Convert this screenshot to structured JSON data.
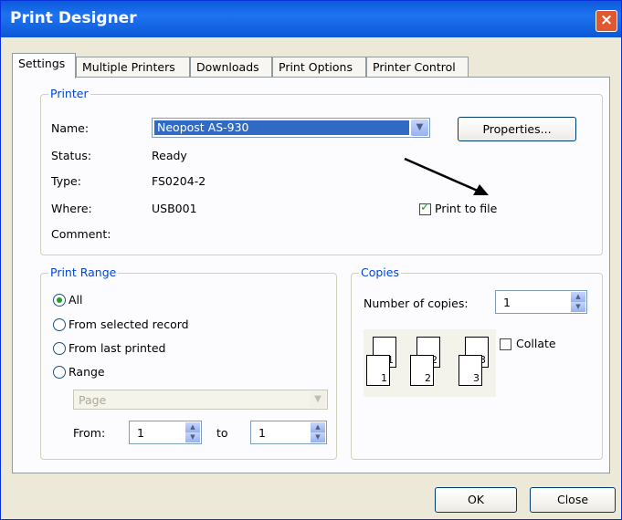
{
  "window": {
    "title": "Print Designer",
    "close_glyph": "×"
  },
  "tabs": [
    "Settings",
    "Multiple Printers",
    "Downloads",
    "Print Options",
    "Printer Control"
  ],
  "printer": {
    "legend": "Printer",
    "name_label": "Name:",
    "name_value": "Neopost AS-930",
    "status_label": "Status:",
    "status_value": "Ready",
    "type_label": "Type:",
    "type_value": "FS0204-2",
    "where_label": "Where:",
    "where_value": "USB001",
    "comment_label": "Comment:",
    "properties_button": "Properties...",
    "print_to_file_label": "Print to file",
    "print_to_file_checked": true
  },
  "print_range": {
    "legend": "Print Range",
    "options": [
      "All",
      "From selected record",
      "From last printed",
      "Range"
    ],
    "selected": "All",
    "range_unit": "Page",
    "from_label": "From:",
    "from_value": "1",
    "to_label": "to",
    "to_value": "1"
  },
  "copies": {
    "legend": "Copies",
    "number_label": "Number of copies:",
    "number_value": "1",
    "collate_label": "Collate",
    "collate_checked": false,
    "page_numbers": [
      "1",
      "1",
      "2",
      "2",
      "3",
      "3"
    ]
  },
  "footer": {
    "ok_button": "OK",
    "close_button": "Close"
  },
  "colors": {
    "title_bar": "#0a5ad9",
    "group_legend": "#0046d5",
    "selection": "#316ac5",
    "check_mark": "#21a121"
  },
  "icons": {
    "close": "close-icon",
    "dropdown": "chevron-down-icon",
    "spin_up": "spin-up-icon",
    "spin_down": "spin-down-icon"
  }
}
